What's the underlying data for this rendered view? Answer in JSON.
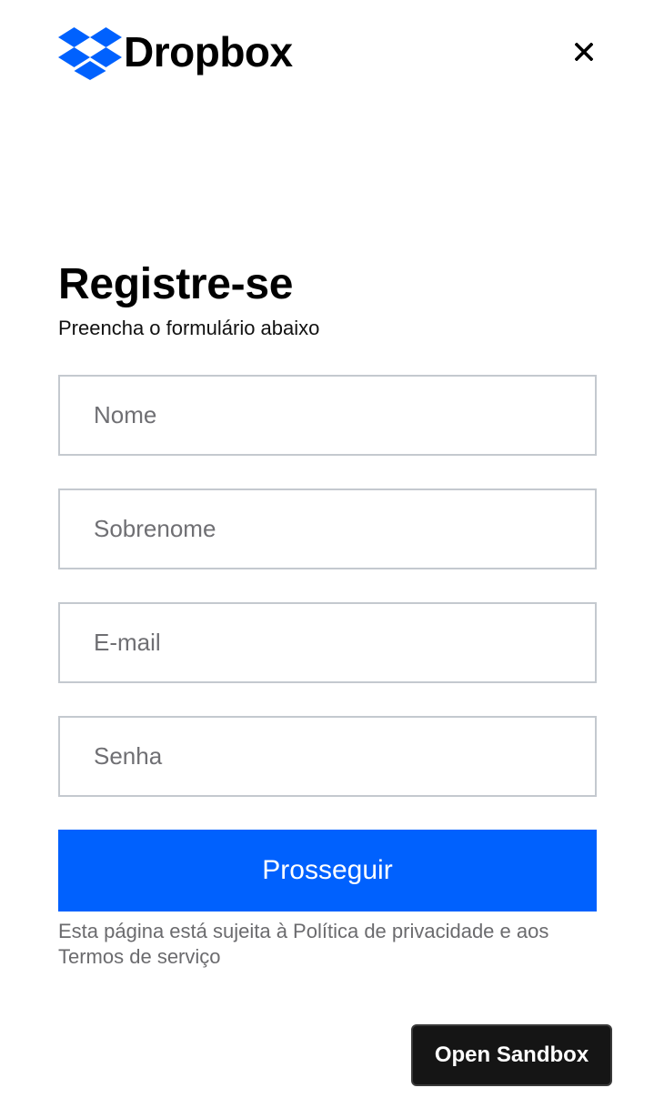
{
  "header": {
    "logo_text": "Dropbox",
    "logo_icon": "dropbox-logo-icon",
    "close_icon": "close-icon"
  },
  "form": {
    "title": "Registre-se",
    "subtitle": "Preencha o formulário abaixo",
    "fields": [
      {
        "placeholder": "Nome",
        "value": ""
      },
      {
        "placeholder": "Sobrenome",
        "value": ""
      },
      {
        "placeholder": "E-mail",
        "value": ""
      },
      {
        "placeholder": "Senha",
        "value": ""
      }
    ],
    "submit_label": "Prosseguir",
    "legal_text": "Esta página está sujeita à Política de privacidade e aos Termos de serviço"
  },
  "sandbox_button": {
    "label": "Open Sandbox"
  },
  "colors": {
    "brand_blue": "#0061fe",
    "field_border": "#c4c9cf",
    "placeholder": "#6f6f73",
    "sandbox_bg": "#151515"
  }
}
